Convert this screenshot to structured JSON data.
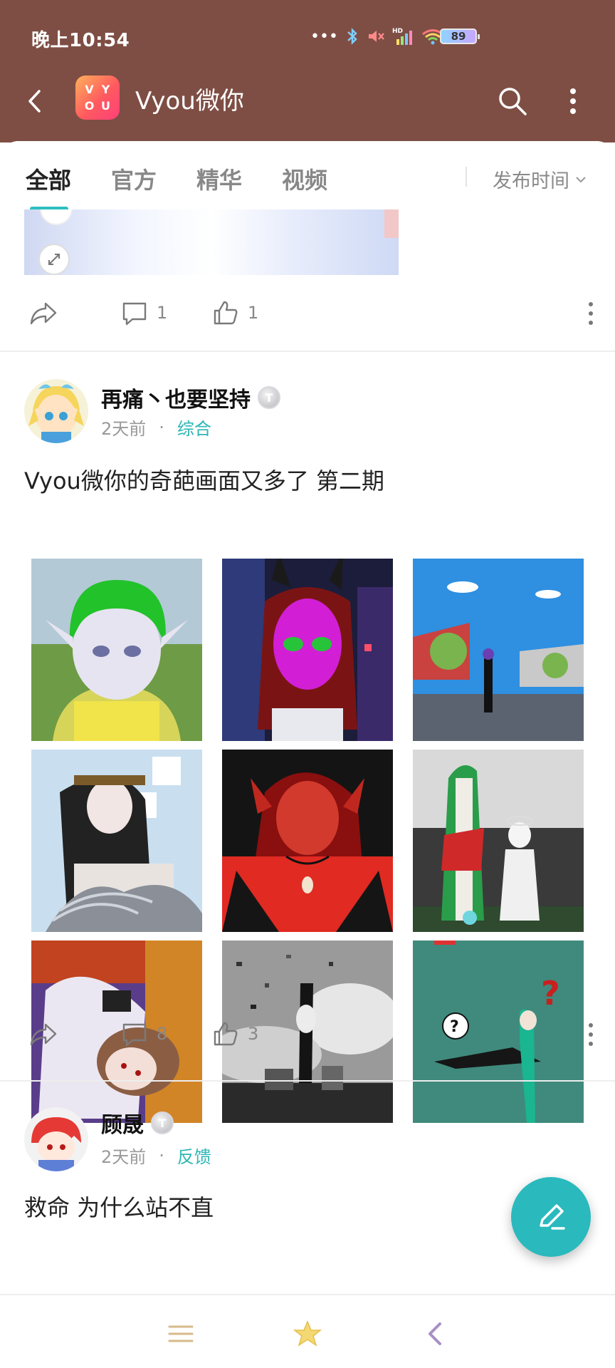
{
  "status_bar": {
    "time": "晚上10:54",
    "battery": "89",
    "icons": [
      "more-dots-icon",
      "bluetooth-icon",
      "mute-icon",
      "signal-hd-icon",
      "wifi-icon",
      "battery-icon"
    ]
  },
  "header": {
    "title": "Vyou微你",
    "logo_letters": [
      "V",
      "Y",
      "O",
      "U"
    ],
    "colors": {
      "bar": "#7e4e44",
      "accent": "#2cb6b5"
    }
  },
  "tabs": {
    "items": [
      "全部",
      "官方",
      "精华",
      "视频"
    ],
    "active": "全部",
    "sort_label": "发布时间"
  },
  "prev_post": {
    "comments": "1",
    "likes": "1"
  },
  "post1": {
    "username": "再痛丶也要坚持",
    "level_badge": "T",
    "time": "2天前",
    "dot": "·",
    "category": "综合",
    "text": "Vyou微你的奇葩画面又多了 第二期",
    "comments": "8",
    "likes": "3",
    "images": [
      "green-hair-elf-avatar",
      "pink-mask-bunny-avatar",
      "blue-sky-scene-avatar",
      "black-hair-chains-avatar",
      "red-skin-demon-avatar",
      "green-dress-angel-scene",
      "lying-brown-hair-avatar",
      "monochrome-falling-avatar",
      "teal-question-marks-avatar"
    ]
  },
  "post2": {
    "username": "顾晟",
    "level_badge": "T",
    "time": "2天前",
    "dot": "·",
    "category": "反馈",
    "text": "救命 为什么站不直"
  },
  "fab": {
    "icon": "compose-pen-icon"
  },
  "bottom_nav": {
    "icons": [
      "menu-icon",
      "star-icon",
      "back-chevron-icon"
    ]
  }
}
